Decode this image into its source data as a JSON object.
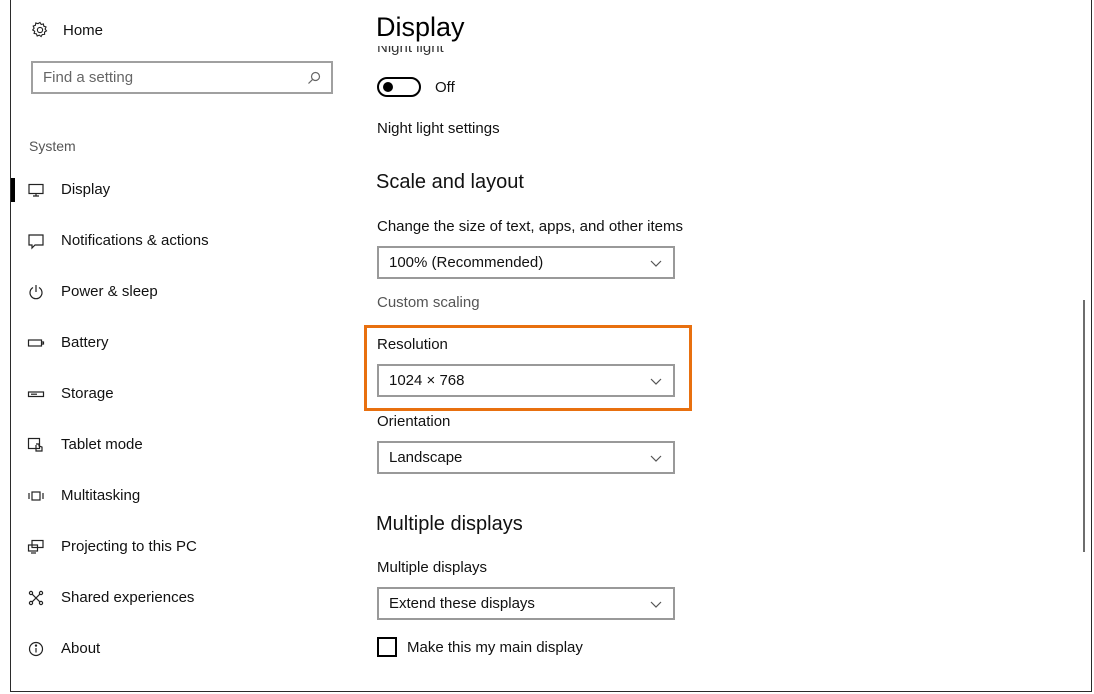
{
  "sidebar": {
    "home_label": "Home",
    "search_placeholder": "Find a setting",
    "section_label": "System",
    "items": [
      {
        "label": "Display",
        "icon": "monitor-icon",
        "active": true
      },
      {
        "label": "Notifications & actions",
        "icon": "notification-icon"
      },
      {
        "label": "Power & sleep",
        "icon": "power-icon"
      },
      {
        "label": "Battery",
        "icon": "battery-icon"
      },
      {
        "label": "Storage",
        "icon": "storage-icon"
      },
      {
        "label": "Tablet mode",
        "icon": "tablet-mode-icon"
      },
      {
        "label": "Multitasking",
        "icon": "multitasking-icon"
      },
      {
        "label": "Projecting to this PC",
        "icon": "projecting-icon"
      },
      {
        "label": "Shared experiences",
        "icon": "shared-experiences-icon"
      },
      {
        "label": "About",
        "icon": "info-icon"
      }
    ]
  },
  "main": {
    "title": "Display",
    "night_light_label": "Night light",
    "night_light_state": "Off",
    "night_light_settings_link": "Night light settings",
    "scale_heading": "Scale and layout",
    "scale_label": "Change the size of text, apps, and other items",
    "scale_value": "100% (Recommended)",
    "custom_scaling": "Custom scaling",
    "resolution_label": "Resolution",
    "resolution_value": "1024 × 768",
    "orientation_label": "Orientation",
    "orientation_value": "Landscape",
    "multiple_heading": "Multiple displays",
    "multiple_label": "Multiple displays",
    "multiple_value": "Extend these displays",
    "main_display_checkbox": "Make this my main display"
  },
  "colors": {
    "highlight": "#e8700f",
    "active_bar": "#000000"
  }
}
